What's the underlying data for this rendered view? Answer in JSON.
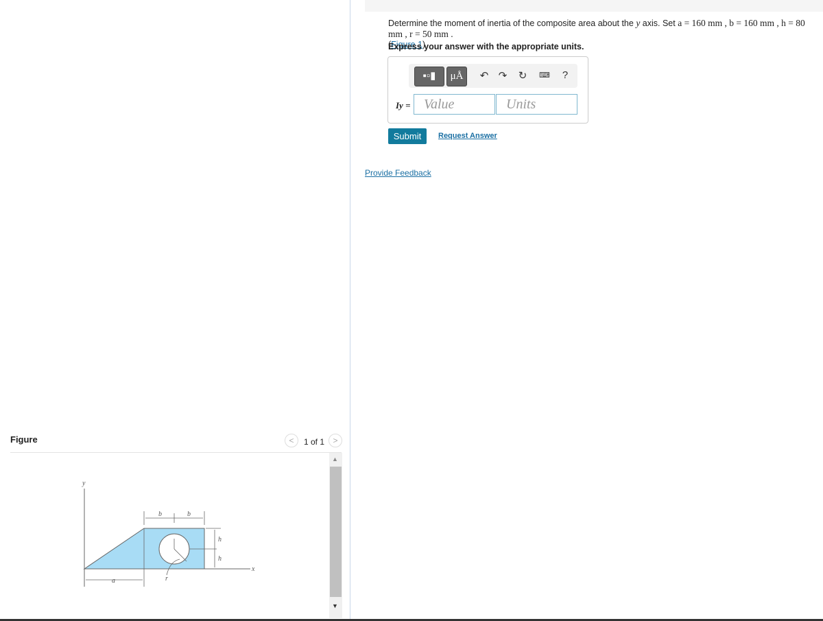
{
  "question": {
    "text_pre": "Determine the moment of inertia of the composite area about the ",
    "axis": "y",
    "text_mid": " axis. Set ",
    "params": "a = 160 mm , b = 160 mm , h = 80 mm , r = 50 mm .",
    "figure_link": "Figure 1",
    "instructions": "Express your answer with the appropriate units."
  },
  "answer": {
    "label": "Iy =",
    "value_placeholder": "Value",
    "units_placeholder": "Units",
    "toolbar": [
      "templates-icon",
      "mu-angstrom-icon",
      "undo-icon",
      "redo-icon",
      "reset-icon",
      "keyboard-icon",
      "help-icon"
    ],
    "mu_label": "μÅ",
    "help_label": "?"
  },
  "buttons": {
    "submit": "Submit",
    "request": "Request Answer",
    "feedback": "Provide Feedback"
  },
  "figure": {
    "title": "Figure",
    "pager": "1 of 1",
    "labels": {
      "y": "y",
      "x": "x",
      "a": "a",
      "b": "b",
      "h": "h",
      "r": "r"
    },
    "fill_color": "#a8dcf5"
  },
  "colors": {
    "accent": "#127b9d",
    "link": "#1a6fa3"
  }
}
